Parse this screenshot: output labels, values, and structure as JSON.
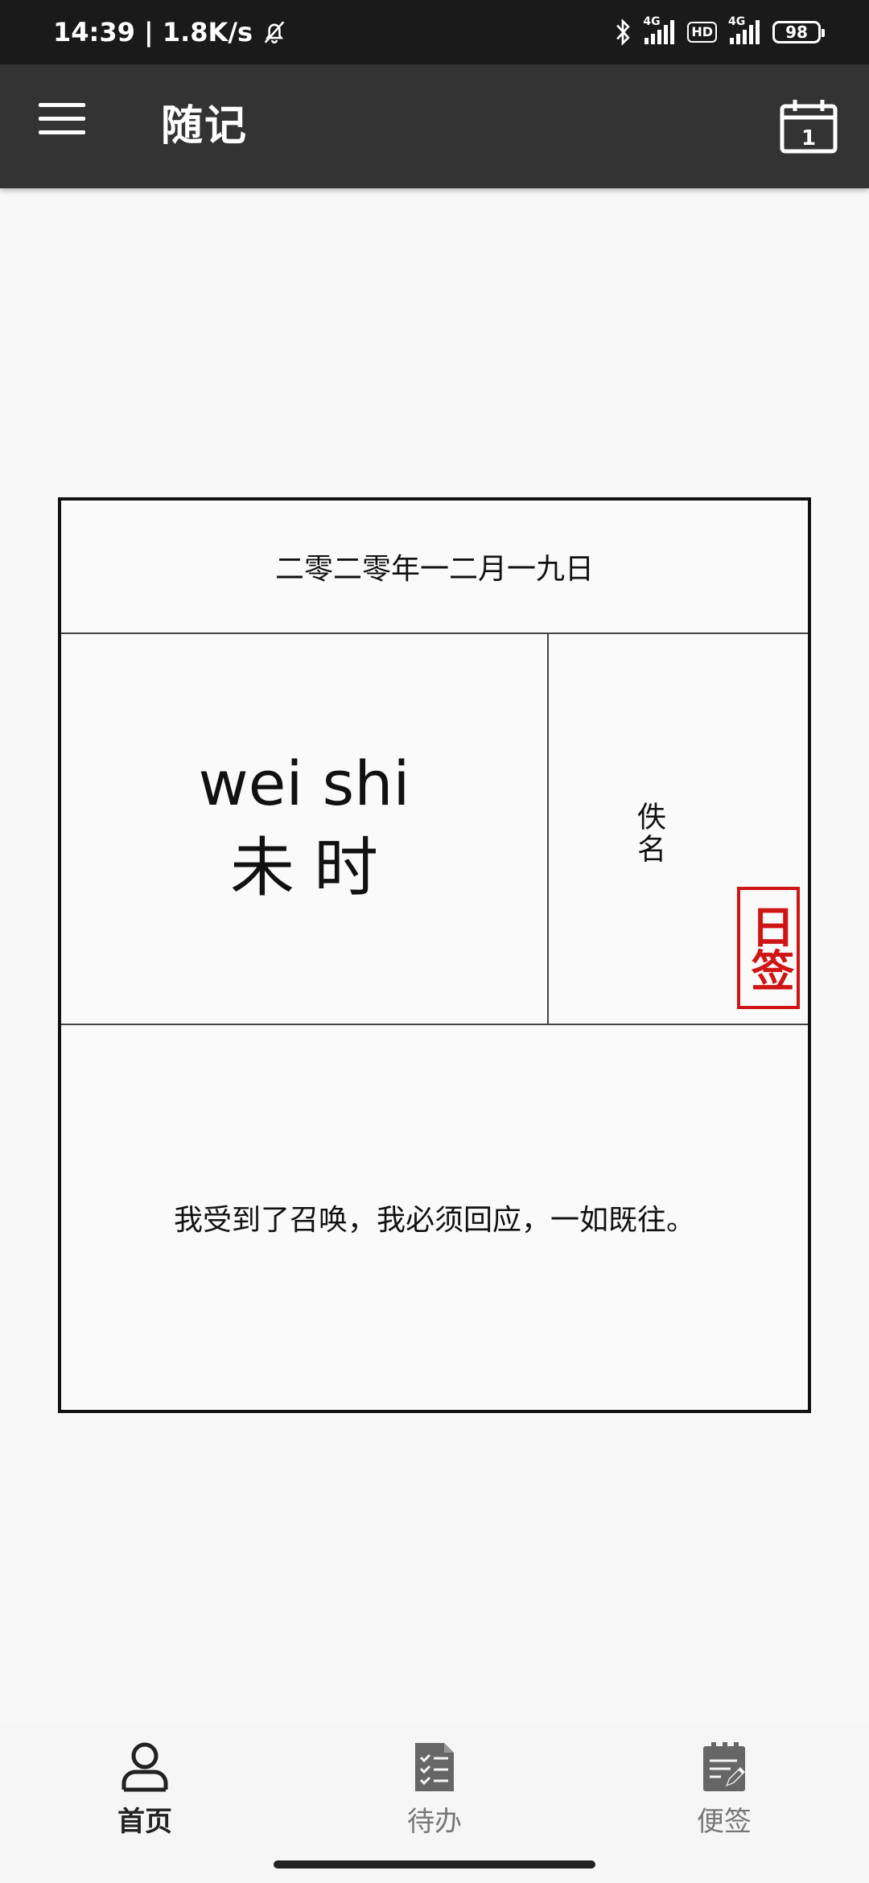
{
  "status_bar": {
    "time": "14:39 | 1.8K/s",
    "sim1_label": "4G",
    "hd_label": "HD",
    "sim2_label": "4G",
    "battery": "98",
    "icons": [
      "bell-off-icon",
      "bluetooth-icon",
      "signal-icon",
      "battery-icon"
    ]
  },
  "app_bar": {
    "title": "随记",
    "calendar_day": "1",
    "icons": [
      "menu-icon",
      "calendar-icon"
    ]
  },
  "card": {
    "date": "二零二零年一二月一九日",
    "pinyin": "wei shi",
    "hour": "未时",
    "author": "佚名",
    "seal_text": "日签",
    "quote": "我受到了召唤，我必须回应，一如既往。"
  },
  "bottom_nav": {
    "items": [
      {
        "label": "首页",
        "icon": "person-icon",
        "active": true
      },
      {
        "label": "待办",
        "icon": "checklist-icon",
        "active": false
      },
      {
        "label": "便签",
        "icon": "note-edit-icon",
        "active": false
      }
    ]
  },
  "colors": {
    "app_bar": "#333333",
    "status_bar": "#1a1a1a",
    "seal_red": "#d01515",
    "background": "#f8f8f8"
  }
}
